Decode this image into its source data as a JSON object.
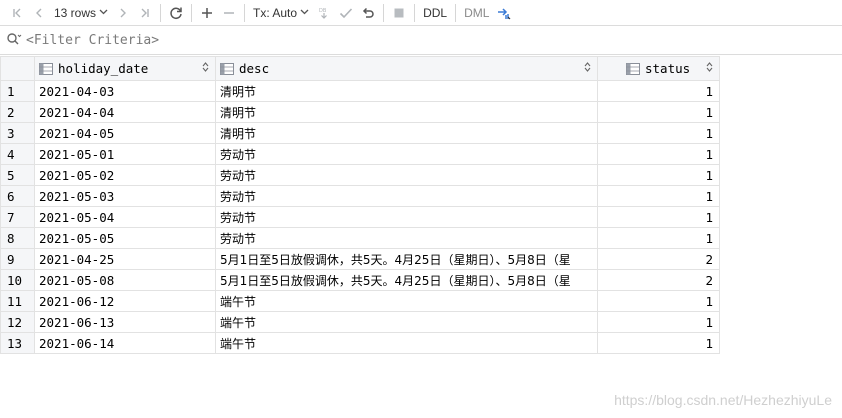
{
  "toolbar": {
    "rows_label": "13 rows",
    "tx_label": "Tx: Auto",
    "ddl_label": "DDL",
    "dml_label": "DML"
  },
  "filter": {
    "placeholder": "<Filter Criteria>"
  },
  "columns": [
    {
      "name": "holiday_date"
    },
    {
      "name": "desc"
    },
    {
      "name": "status"
    }
  ],
  "rows": [
    {
      "num": "1",
      "holiday_date": "2021-04-03",
      "desc": "清明节",
      "status": "1"
    },
    {
      "num": "2",
      "holiday_date": "2021-04-04",
      "desc": "清明节",
      "status": "1"
    },
    {
      "num": "3",
      "holiday_date": "2021-04-05",
      "desc": "清明节",
      "status": "1"
    },
    {
      "num": "4",
      "holiday_date": "2021-05-01",
      "desc": "劳动节",
      "status": "1"
    },
    {
      "num": "5",
      "holiday_date": "2021-05-02",
      "desc": "劳动节",
      "status": "1"
    },
    {
      "num": "6",
      "holiday_date": "2021-05-03",
      "desc": "劳动节",
      "status": "1"
    },
    {
      "num": "7",
      "holiday_date": "2021-05-04",
      "desc": "劳动节",
      "status": "1"
    },
    {
      "num": "8",
      "holiday_date": "2021-05-05",
      "desc": "劳动节",
      "status": "1"
    },
    {
      "num": "9",
      "holiday_date": "2021-04-25",
      "desc": "5月1日至5日放假调休，共5天。4月25日（星期日）、5月8日（星",
      "status": "2"
    },
    {
      "num": "10",
      "holiday_date": "2021-05-08",
      "desc": "5月1日至5日放假调休，共5天。4月25日（星期日）、5月8日（星",
      "status": "2"
    },
    {
      "num": "11",
      "holiday_date": "2021-06-12",
      "desc": "端午节",
      "status": "1"
    },
    {
      "num": "12",
      "holiday_date": "2021-06-13",
      "desc": "端午节",
      "status": "1"
    },
    {
      "num": "13",
      "holiday_date": "2021-06-14",
      "desc": "端午节",
      "status": "1"
    }
  ],
  "watermark": "https://blog.csdn.net/HezhezhiyuLe"
}
